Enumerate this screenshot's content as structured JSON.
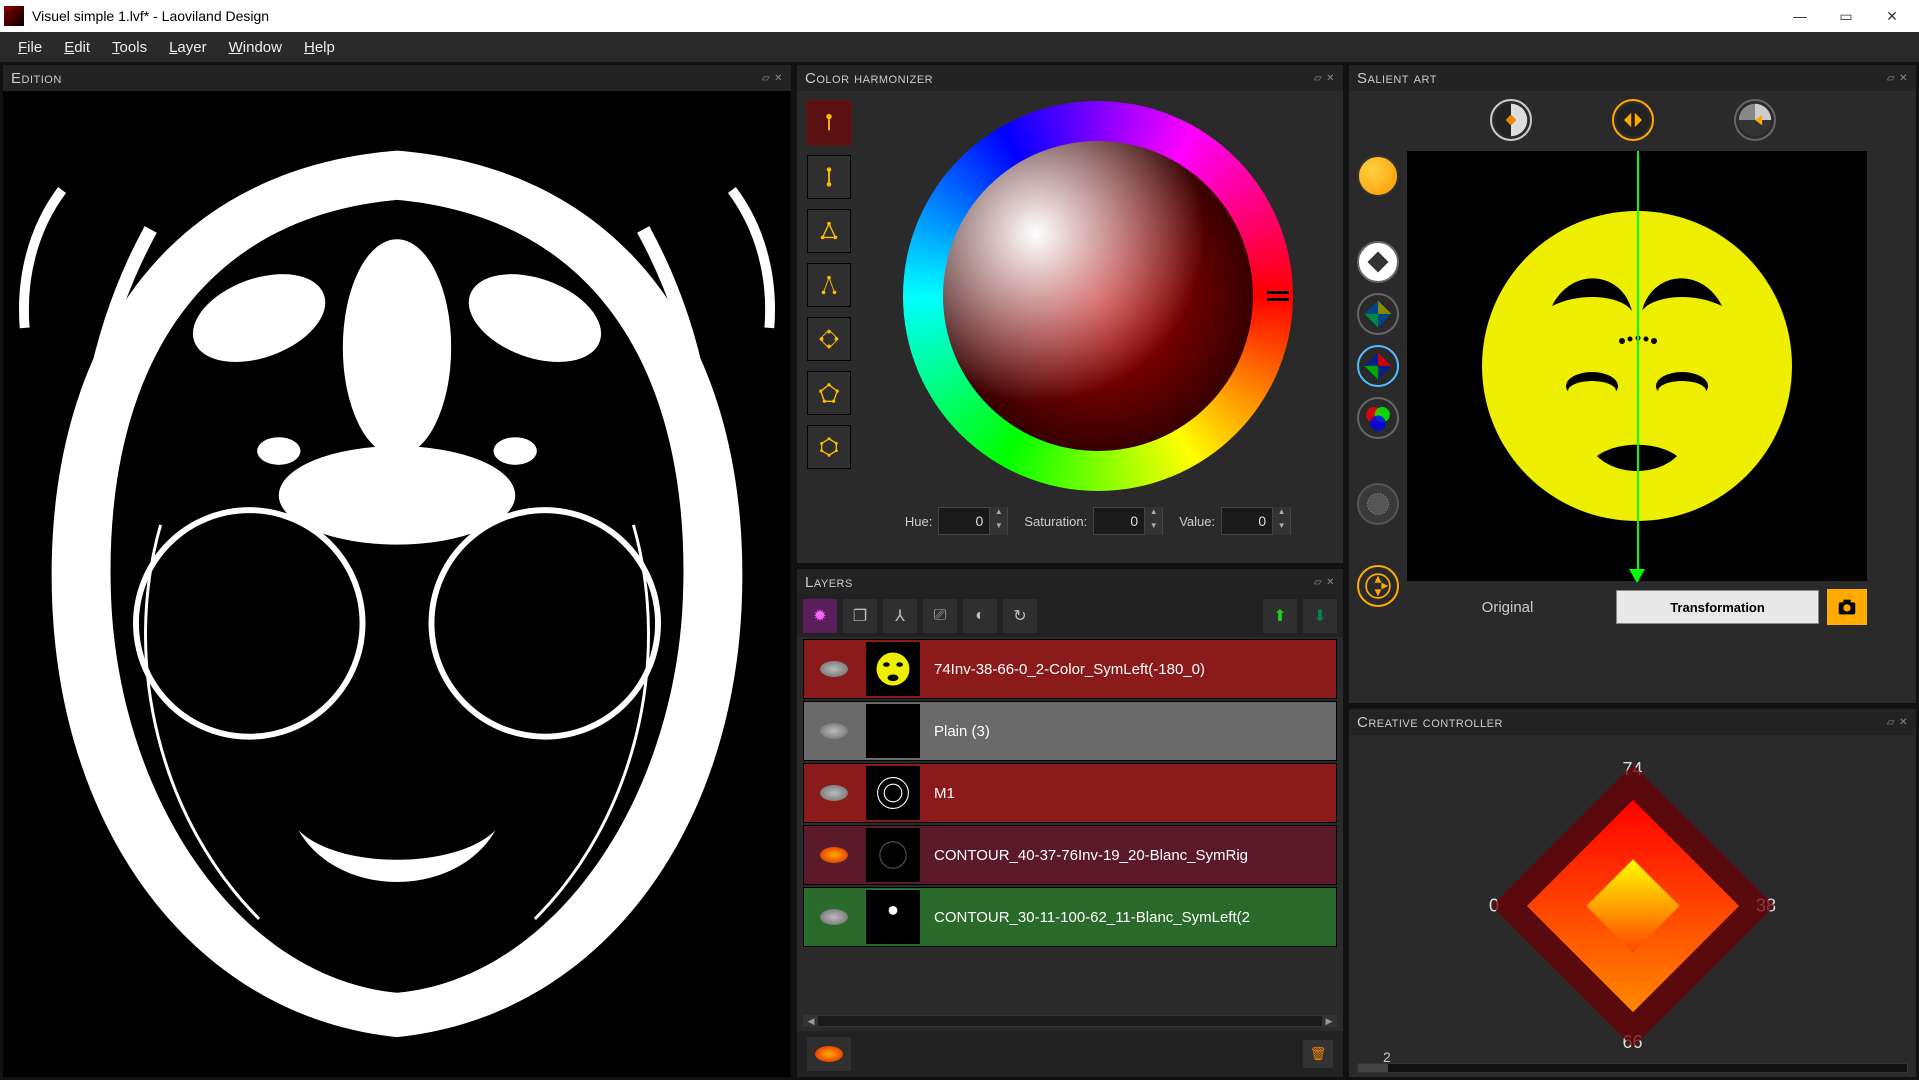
{
  "window": {
    "title": "Visuel simple 1.lvf* - Laoviland Design"
  },
  "menu": {
    "file": "File",
    "edit": "Edit",
    "tools": "Tools",
    "layer": "Layer",
    "window": "Window",
    "help": "Help"
  },
  "panels": {
    "edition": "Edition",
    "colorHarmonizer": "Color harmonizer",
    "layers": "Layers",
    "salientArt": "Salient art",
    "creativeController": "Creative controller"
  },
  "colorHarmonizer": {
    "hueLabel": "Hue:",
    "hueValue": "0",
    "satLabel": "Saturation:",
    "satValue": "0",
    "valLabel": "Value:",
    "valValue": "0"
  },
  "layers": {
    "items": [
      {
        "name": "74Inv-38-66-0_2-Color_SymLeft(-180_0)",
        "color": "red",
        "thumb": "yellowface"
      },
      {
        "name": "Plain (3)",
        "color": "grey",
        "thumb": "black"
      },
      {
        "name": "M1",
        "color": "red",
        "thumb": "bw"
      },
      {
        "name": "CONTOUR_40-37-76Inv-19_20-Blanc_SymRig",
        "color": "dark",
        "thumb": "dim"
      },
      {
        "name": "CONTOUR_30-11-100-62_11-Blanc_SymLeft(2",
        "color": "green",
        "thumb": "dot"
      }
    ]
  },
  "salient": {
    "originalLabel": "Original",
    "transformLabel": "Transformation"
  },
  "creative": {
    "top": "74",
    "right": "38",
    "bottom": "66",
    "left": "0",
    "scroll": "2"
  }
}
